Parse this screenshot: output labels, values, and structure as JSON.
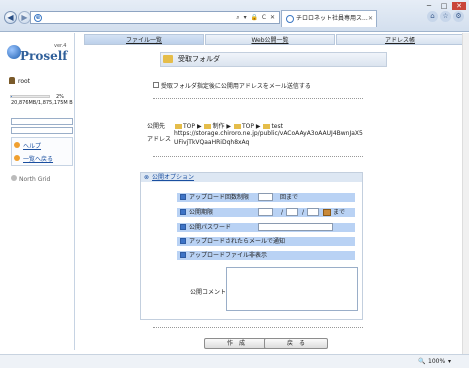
{
  "browser": {
    "back_glyph": "◀",
    "forward_glyph": "▶",
    "address_tools": "⌕ ▾ 🔒 C ✕",
    "tab_title": "チロロネット社員専用ス...",
    "tab_close": "✕",
    "toolbar_icons": [
      "home-icon",
      "star-icon",
      "gear-icon"
    ],
    "toolbar_glyphs": [
      "⌂",
      "☆",
      "⚙"
    ],
    "window_buttons": [
      "─",
      "□",
      "✕"
    ]
  },
  "sidebar": {
    "logo_word": "Proself",
    "logo_version": "ver.4",
    "user": "root",
    "usage_percent": 2,
    "usage_percent_text": "2%",
    "quota_text": "20,876MB/1,875,175M B",
    "help_link": "ヘルプ",
    "back_link": "一覧へ戻る",
    "brand": "North Grid"
  },
  "main": {
    "tabs": [
      "ファイル一覧",
      "Web公開一覧",
      "アドレス帳"
    ],
    "header_title": "受取フォルダ",
    "email_notice_label": "受取フォルダ指定後に公開用アドレスをメール送信する",
    "public_dest_label": "公開先",
    "path": [
      "TOP",
      "制作",
      "TOP",
      "test"
    ],
    "path_sep": "▶",
    "address_label": "アドレス",
    "address_url": "https://storage.chiroro.ne.jp/public/vACoAAyA3oAAUJ4BwnJaX5UFivjTkVQaaHRiDqh8xAq",
    "options_link": "公開オプション",
    "options_icon_glyph": "⊗",
    "options": {
      "upload_count_label": "アップロード回数制限",
      "upload_count_suffix": "回まで",
      "period_label": "公開期限",
      "date_sep": "/",
      "period_suffix": "まで",
      "password_label": "公開パスワード",
      "notify_label": "アップロードされたらメールで通知",
      "hide_label": "アップロードファイル非表示"
    },
    "comment_label": "公開コメント",
    "create_button": "作　成",
    "back_button": "戻　る"
  },
  "status": {
    "zoom": "100%",
    "zoom_glyph": "🔍",
    "dropdown_glyph": "▾"
  }
}
